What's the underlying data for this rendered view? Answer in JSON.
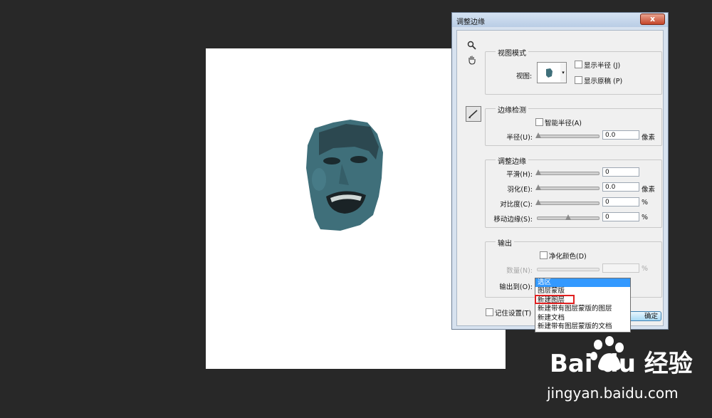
{
  "dialog": {
    "title": "调整边缘",
    "close_label": "x",
    "view_mode": {
      "group_label": "视图模式",
      "view_label": "视图:",
      "show_radius": "显示半径 (J)",
      "show_original": "显示原稿 (P)"
    },
    "edge_detection": {
      "group_label": "边缘检测",
      "smart_radius": "智能半径(A)",
      "radius_label": "半径(U):",
      "radius_value": "0.0",
      "radius_unit": "像素"
    },
    "adjust_edge": {
      "group_label": "调整边缘",
      "smooth_label": "平滑(H):",
      "smooth_value": "0",
      "feather_label": "羽化(E):",
      "feather_value": "0.0",
      "feather_unit": "像素",
      "contrast_label": "对比度(C):",
      "contrast_value": "0",
      "contrast_unit": "%",
      "shift_label": "移动边缘(S):",
      "shift_value": "0",
      "shift_unit": "%"
    },
    "output": {
      "group_label": "输出",
      "decontaminate": "净化颜色(D)",
      "amount_label": "数量(N):",
      "amount_unit": "%",
      "output_to_label": "输出到(O):",
      "output_to_value": "选区",
      "options": [
        "选区",
        "图层蒙版",
        "新建图层",
        "新建带有图层蒙版的图层",
        "新建文档",
        "新建带有图层蒙版的文档"
      ]
    },
    "remember": "记住设置(T)",
    "ok_label": "确定"
  },
  "watermark": {
    "logo_text": "Bai du 经验",
    "url": "jingyan.baidu.com"
  },
  "icons": [
    "zoom-icon",
    "hand-icon",
    "refine-radius-brush-icon",
    "dropdown-arrow-icon",
    "baidu-paw-icon"
  ]
}
